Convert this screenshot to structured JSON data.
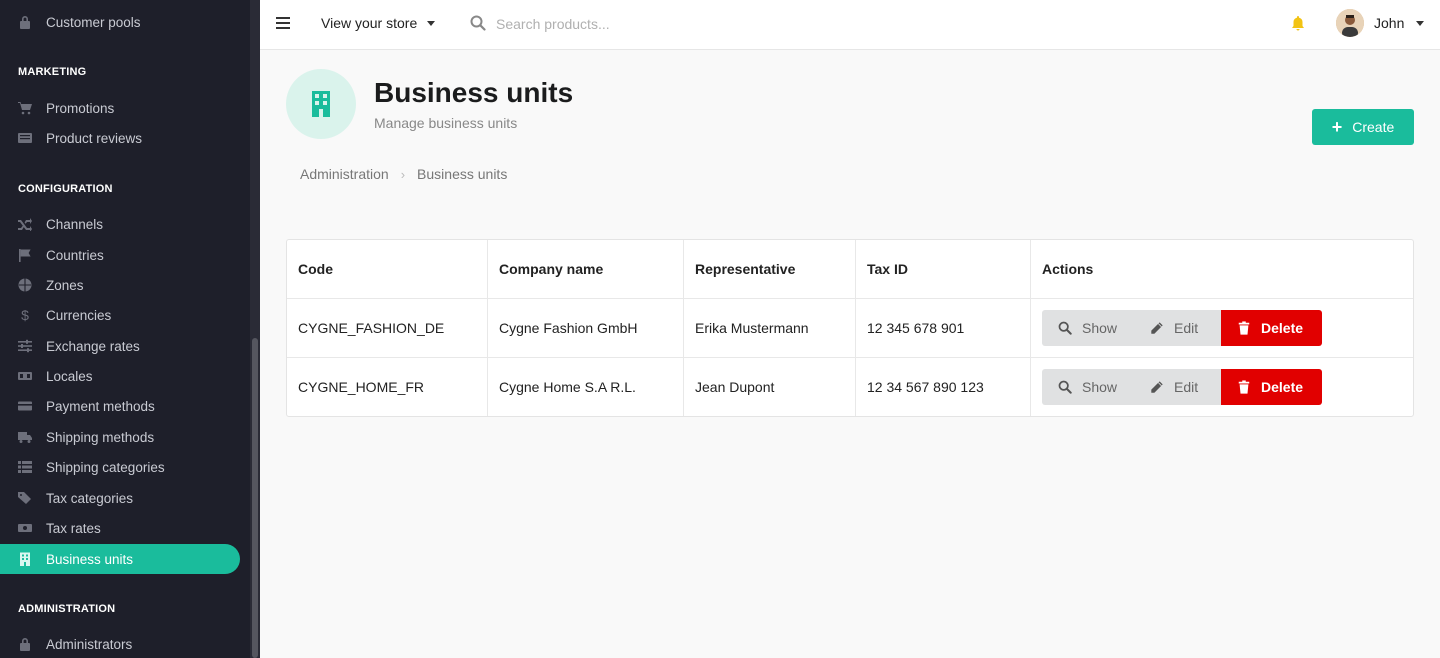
{
  "sidebar": {
    "top_item": "Customer pools",
    "sections": [
      {
        "title": "MARKETING",
        "items": [
          {
            "label": "Promotions",
            "icon": "cart-icon"
          },
          {
            "label": "Product reviews",
            "icon": "newspaper-icon"
          }
        ]
      },
      {
        "title": "CONFIGURATION",
        "items": [
          {
            "label": "Channels",
            "icon": "shuffle-icon"
          },
          {
            "label": "Countries",
            "icon": "flag-icon"
          },
          {
            "label": "Zones",
            "icon": "globe-icon"
          },
          {
            "label": "Currencies",
            "icon": "dollar-icon"
          },
          {
            "label": "Exchange rates",
            "icon": "sliders-icon"
          },
          {
            "label": "Locales",
            "icon": "translate-icon"
          },
          {
            "label": "Payment methods",
            "icon": "credit-card-icon"
          },
          {
            "label": "Shipping methods",
            "icon": "truck-icon"
          },
          {
            "label": "Shipping categories",
            "icon": "list-icon"
          },
          {
            "label": "Tax categories",
            "icon": "tags-icon"
          },
          {
            "label": "Tax rates",
            "icon": "money-icon"
          },
          {
            "label": "Business units",
            "icon": "building-icon",
            "active": true
          }
        ]
      },
      {
        "title": "ADMINISTRATION",
        "items": [
          {
            "label": "Administrators",
            "icon": "lock-icon"
          }
        ]
      }
    ]
  },
  "topbar": {
    "store_link": "View your store",
    "search_placeholder": "Search products...",
    "user_name": "John"
  },
  "header": {
    "title": "Business units",
    "subtitle": "Manage business units",
    "create_label": "Create"
  },
  "breadcrumb": [
    "Administration",
    "Business units"
  ],
  "table": {
    "columns": [
      "Code",
      "Company name",
      "Representative",
      "Tax ID",
      "Actions"
    ],
    "rows": [
      {
        "code": "CYGNE_FASHION_DE",
        "company": "Cygne Fashion GmbH",
        "representative": "Erika Mustermann",
        "tax_id": "12 345 678 901"
      },
      {
        "code": "CYGNE_HOME_FR",
        "company": "Cygne Home S.A R.L.",
        "representative": "Jean Dupont",
        "tax_id": "12 34 567 890 123"
      }
    ],
    "actions": {
      "show": "Show",
      "edit": "Edit",
      "delete": "Delete"
    }
  },
  "colors": {
    "accent": "#1abc9c",
    "danger": "#e10000",
    "sidebar_bg": "#1e1f2a"
  }
}
